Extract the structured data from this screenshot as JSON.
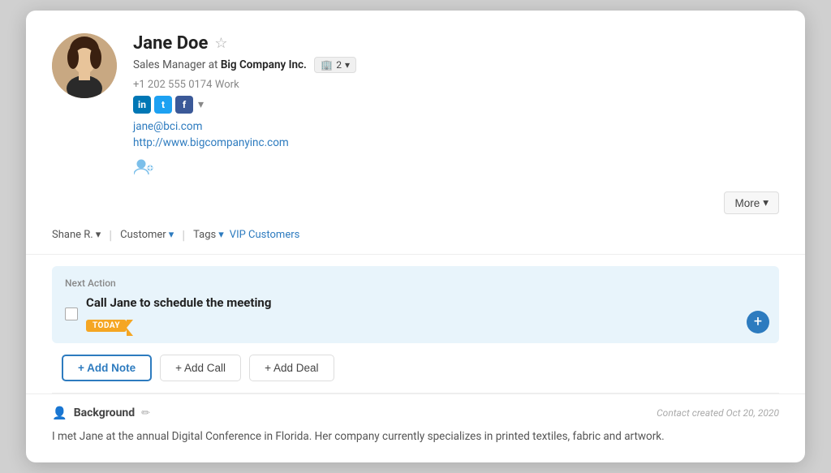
{
  "profile": {
    "name": "Jane Doe",
    "title": "Sales Manager at",
    "company": "Big Company Inc.",
    "company_count": "2",
    "phone": "+1 202 555 0174",
    "phone_type": "Work",
    "email": "jane@bci.com",
    "website": "http://www.bigcompanyinc.com"
  },
  "social": {
    "linkedin_label": "in",
    "twitter_label": "t",
    "facebook_label": "f",
    "more_label": "▾"
  },
  "toolbar": {
    "more_label": "More",
    "more_chevron": "▾"
  },
  "tags": {
    "owner_label": "Shane R.",
    "owner_chevron": "▾",
    "customer_label": "Customer",
    "customer_chevron": "▾",
    "tags_label": "Tags",
    "tags_chevron": "▾",
    "vip_label": "VIP Customers"
  },
  "next_action": {
    "section_label": "Next Action",
    "task_text": "Call Jane to schedule the meeting",
    "today_badge": "TODAY",
    "add_icon": "+"
  },
  "buttons": {
    "add_note": "+ Add Note",
    "add_call": "+ Add Call",
    "add_deal": "+ Add Deal"
  },
  "background": {
    "section_title": "Background",
    "created_text": "Contact created Oct 20, 2020",
    "body_text": "I met Jane at the annual Digital Conference in Florida. Her company currently specializes in printed textiles, fabric and artwork."
  }
}
